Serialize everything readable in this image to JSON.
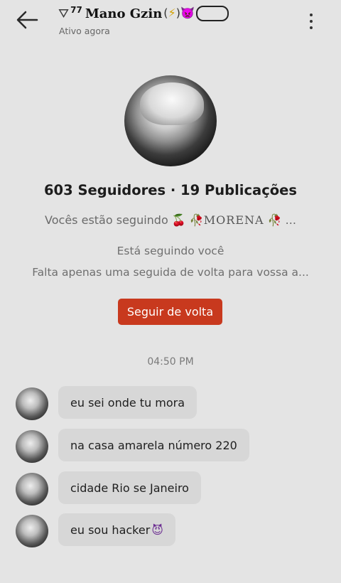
{
  "header": {
    "back_icon": "arrow-left-icon",
    "title_prefix_glyph": "⛛",
    "title_sup": "77",
    "title": "Mano Gzin",
    "title_suffix_open": "(",
    "title_suffix_bolt": "⚡",
    "title_suffix_mid": ")",
    "title_suffix_demon": "👿",
    "status": "Ativo agora",
    "menu_icon": "kebab-menu-icon"
  },
  "profile": {
    "stats": "603 Seguidores · 19 Publicações",
    "mutuals_prefix": "Vocês estão seguindo",
    "mutuals_cherry": "🍒",
    "mutuals_rose": "🥀",
    "mutuals_name": "MORENA",
    "mutuals_rose2": "🥀",
    "mutuals_ellipsis": "...",
    "follows_you": "Está seguindo você",
    "missing_follow": "Falta apenas uma seguida de volta para vossa a...",
    "follow_back_label": "Seguir de volta"
  },
  "chat": {
    "timestamp": "04:50 PM",
    "messages": [
      {
        "text": "eu sei onde tu mora"
      },
      {
        "text": "na casa amarela número 220"
      },
      {
        "text": "cidade Rio se Janeiro"
      },
      {
        "text": "eu sou hacker",
        "emoji": "😈"
      }
    ]
  },
  "colors": {
    "background": "#e4e4e4",
    "accent_button": "#c8391e",
    "bubble": "#d7d7d7"
  }
}
